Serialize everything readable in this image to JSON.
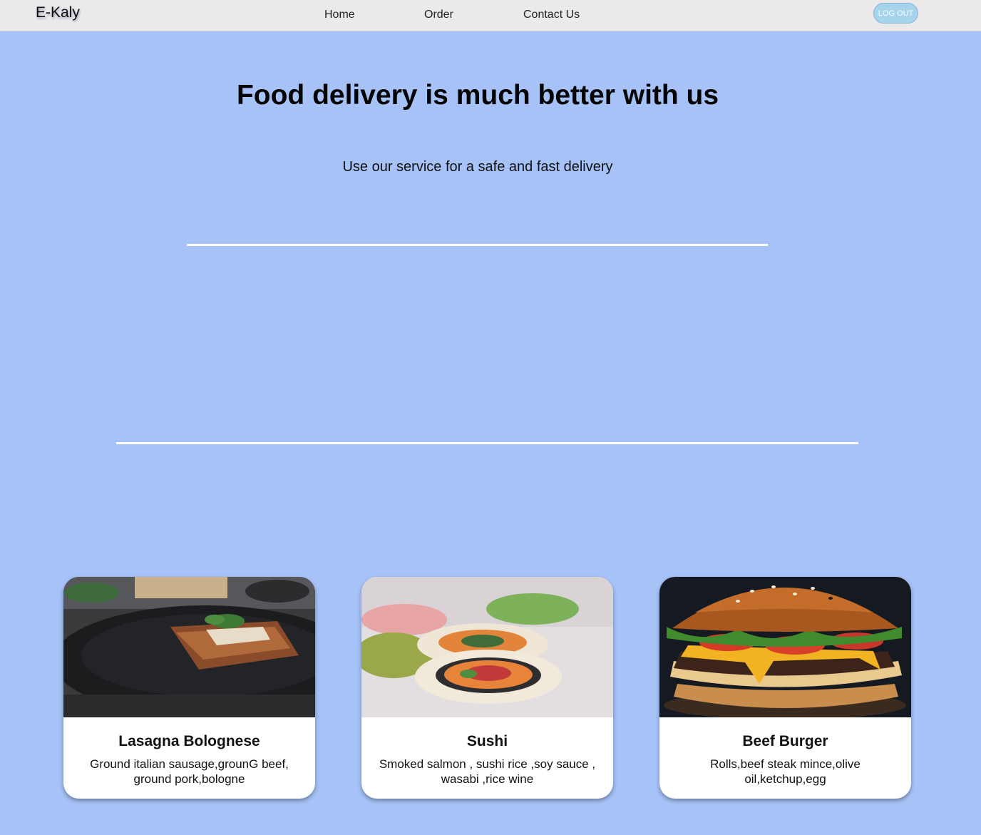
{
  "nav": {
    "brand": "E-Kaly",
    "links": [
      "Home",
      "Order",
      "Contact Us"
    ],
    "logout_label": "LOG OUT"
  },
  "hero": {
    "title": "Food delivery is much better with us",
    "subtitle": "Use our service for a safe and fast delivery"
  },
  "cards": [
    {
      "title": "Lasagna Bolognese",
      "description": "Ground italian sausage,grounG beef, ground pork,bologne"
    },
    {
      "title": "Sushi",
      "description": "Smoked salmon , sushi rice ,soy sauce , wasabi ,rice wine"
    },
    {
      "title": "Beef Burger",
      "description": "Rolls,beef steak mince,olive oil,ketchup,egg"
    }
  ],
  "colors": {
    "background": "#a6c2f6",
    "navbar": "#ebe9e9",
    "logout_button": "#a5d4ec",
    "card": "#ffffff",
    "divider": "#ffffff"
  }
}
